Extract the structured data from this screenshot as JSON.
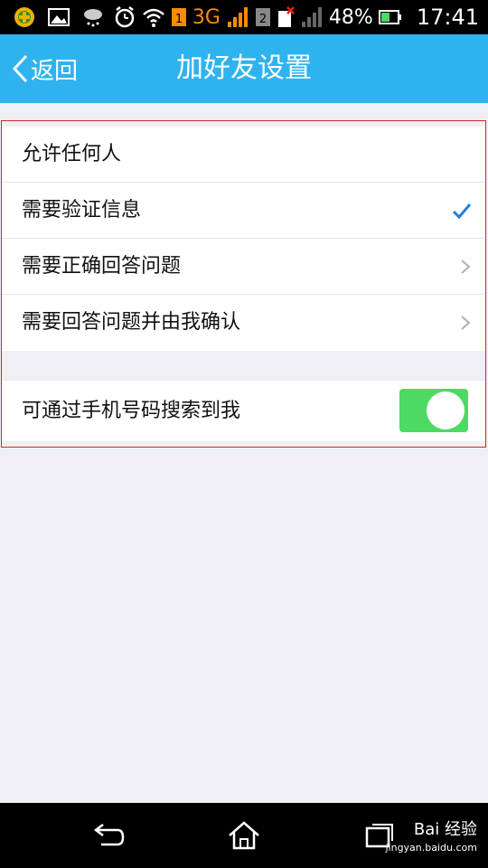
{
  "status": {
    "network": "3G",
    "sim2": "2",
    "battery": "48%",
    "time": "17:41"
  },
  "header": {
    "back_label": "返回",
    "title": "加好友设置"
  },
  "options": [
    {
      "label": "允许任何人",
      "state": "none"
    },
    {
      "label": "需要验证信息",
      "state": "selected"
    },
    {
      "label": "需要正确回答问题",
      "state": "chevron"
    },
    {
      "label": "需要回答问题并由我确认",
      "state": "chevron"
    }
  ],
  "phone_search": {
    "label": "可通过手机号码搜索到我",
    "enabled": true
  },
  "watermark": {
    "brand": "Bai 经验",
    "url": "jingyan.baidu.com"
  },
  "colors": {
    "accent": "#2fb3ef",
    "toggle_on": "#4cd964",
    "check": "#1e7fe0"
  }
}
